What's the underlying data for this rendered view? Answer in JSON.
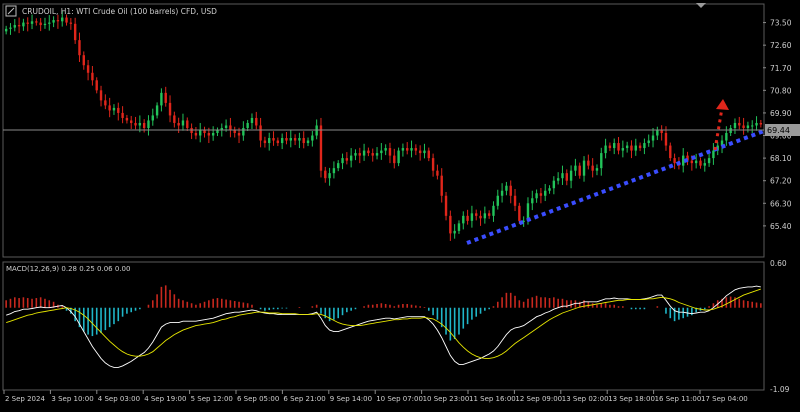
{
  "window": {
    "symbol_line": "CRUDOIL, H1:  WTI Crude Oil (100 barrels) CFD, USD",
    "current_price_tag": "69.44"
  },
  "colors": {
    "background": "#000000",
    "up_candle": "#22c35a",
    "down_candle": "#e0261b",
    "grid_line": "#7a7a7a",
    "trendline_blue": "#3a4dff",
    "arrow_red": "#e0261b",
    "macd_hist_pos": "#c8281e",
    "macd_hist_neg": "#1fb6c8",
    "macd_line": "#ffffff",
    "signal_line": "#e6e600",
    "text": "#cfcfcf"
  },
  "icons": [
    "window-menu-icon",
    "scroll-marker-icon"
  ],
  "chart_data": [
    {
      "type": "candlestick",
      "title": "CRUDOIL, H1:  WTI Crude Oil (100 barrels) CFD, USD",
      "ylim": [
        64.2,
        74.2
      ],
      "y_ticks": [
        "73.50",
        "72.60",
        "71.70",
        "70.80",
        "69.90",
        "69.00",
        "68.10",
        "67.20",
        "66.30",
        "65.40"
      ],
      "x_labels": [
        "2 Sep 2024",
        "3 Sep 10:00",
        "4 Sep 03:00",
        "4 Sep 19:00",
        "5 Sep 12:00",
        "6 Sep 05:00",
        "6 Sep 21:00",
        "9 Sep 14:00",
        "10 Sep 07:00",
        "10 Sep 23:00",
        "11 Sep 16:00",
        "12 Sep 09:00",
        "13 Sep 02:00",
        "13 Sep 18:00",
        "16 Sep 11:00",
        "17 Sep 04:00"
      ],
      "current_price": 69.44,
      "close": [
        73.25,
        73.3,
        73.4,
        73.35,
        73.5,
        73.45,
        73.55,
        73.5,
        73.4,
        73.45,
        73.5,
        73.6,
        73.55,
        73.7,
        73.5,
        73.45,
        72.8,
        72.2,
        71.8,
        71.5,
        71.2,
        70.8,
        70.4,
        70.2,
        70.0,
        70.1,
        69.9,
        69.7,
        69.6,
        69.5,
        69.4,
        69.5,
        69.3,
        69.6,
        69.8,
        70.2,
        70.7,
        70.3,
        69.8,
        69.5,
        69.4,
        69.6,
        69.3,
        69.1,
        69.0,
        69.2,
        69.1,
        69.0,
        69.1,
        69.2,
        69.3,
        69.4,
        69.2,
        69.1,
        69.0,
        69.3,
        69.5,
        69.7,
        69.4,
        68.8,
        68.7,
        68.9,
        68.8,
        68.7,
        68.9,
        68.8,
        68.9,
        68.8,
        68.9,
        68.7,
        68.8,
        69.0,
        69.4,
        67.6,
        67.3,
        67.5,
        67.7,
        67.9,
        68.1,
        68.0,
        68.2,
        68.3,
        68.2,
        68.4,
        68.3,
        68.2,
        68.3,
        68.4,
        68.5,
        68.2,
        67.9,
        68.4,
        68.5,
        68.4,
        68.5,
        68.4,
        68.3,
        68.4,
        68.1,
        67.6,
        67.4,
        66.6,
        65.8,
        65.1,
        65.2,
        65.5,
        65.8,
        65.6,
        65.9,
        65.8,
        65.7,
        65.9,
        65.8,
        66.2,
        66.6,
        66.8,
        67.0,
        66.6,
        66.2,
        65.6,
        65.6,
        66.3,
        66.5,
        66.7,
        66.6,
        66.8,
        66.9,
        67.2,
        67.3,
        67.5,
        67.2,
        67.6,
        67.8,
        67.4,
        68.0,
        67.8,
        67.6,
        67.7,
        68.3,
        68.6,
        68.5,
        68.7,
        68.4,
        68.5,
        68.6,
        68.4,
        68.6,
        68.5,
        68.7,
        68.8,
        69.0,
        69.2,
        69.1,
        68.6,
        68.1,
        67.9,
        67.8,
        68.2,
        68.0,
        67.9,
        68.0,
        67.8,
        67.9,
        68.1,
        68.4,
        68.6,
        68.8,
        69.1,
        69.3,
        69.5,
        69.4,
        69.3,
        69.4,
        69.4,
        69.5,
        69.44
      ]
    },
    {
      "type": "macd",
      "label": "MACD(12,26,9) 0.28 0.25 0.06 0.00",
      "ylim": [
        -1.09,
        0.6
      ],
      "y_ticks": [
        "0.60",
        "-1.09"
      ],
      "histogram": [
        0.1,
        0.12,
        0.14,
        0.13,
        0.14,
        0.13,
        0.12,
        0.13,
        0.14,
        0.12,
        0.1,
        0.08,
        0.04,
        0.02,
        -0.04,
        -0.08,
        -0.18,
        -0.26,
        -0.32,
        -0.36,
        -0.38,
        -0.36,
        -0.34,
        -0.3,
        -0.26,
        -0.22,
        -0.18,
        -0.12,
        -0.08,
        -0.06,
        -0.04,
        -0.02,
        0.0,
        0.04,
        0.1,
        0.18,
        0.28,
        0.3,
        0.24,
        0.18,
        0.12,
        0.1,
        0.08,
        0.06,
        0.04,
        0.06,
        0.08,
        0.1,
        0.12,
        0.13,
        0.12,
        0.11,
        0.1,
        0.09,
        0.08,
        0.07,
        0.06,
        0.04,
        0.0,
        -0.02,
        -0.04,
        -0.03,
        -0.02,
        -0.02,
        -0.01,
        -0.01,
        0.0,
        0.0,
        0.01,
        0.0,
        0.0,
        0.02,
        0.04,
        -0.08,
        -0.14,
        -0.18,
        -0.16,
        -0.14,
        -0.1,
        -0.06,
        -0.04,
        -0.02,
        0.0,
        0.02,
        0.04,
        0.04,
        0.05,
        0.06,
        0.05,
        0.04,
        0.02,
        0.04,
        0.05,
        0.05,
        0.04,
        0.03,
        0.02,
        0.01,
        -0.04,
        -0.1,
        -0.16,
        -0.26,
        -0.36,
        -0.44,
        -0.42,
        -0.36,
        -0.28,
        -0.22,
        -0.16,
        -0.12,
        -0.08,
        -0.04,
        -0.02,
        0.02,
        0.08,
        0.14,
        0.2,
        0.2,
        0.16,
        0.1,
        0.08,
        0.12,
        0.14,
        0.16,
        0.14,
        0.14,
        0.13,
        0.14,
        0.12,
        0.12,
        0.1,
        0.1,
        0.1,
        0.08,
        0.1,
        0.08,
        0.06,
        0.04,
        0.06,
        0.06,
        0.04,
        0.04,
        0.02,
        0.02,
        0.0,
        -0.02,
        -0.02,
        -0.02,
        -0.02,
        0.0,
        0.0,
        0.02,
        0.0,
        -0.08,
        -0.14,
        -0.18,
        -0.16,
        -0.14,
        -0.12,
        -0.1,
        -0.06,
        -0.04,
        -0.02,
        0.02,
        0.06,
        0.1,
        0.12,
        0.14,
        0.15,
        0.14,
        0.12,
        0.1,
        0.09,
        0.08,
        0.07,
        0.06
      ],
      "macd": [
        -0.1,
        -0.08,
        -0.05,
        -0.04,
        -0.02,
        -0.02,
        -0.01,
        0.0,
        0.01,
        0.0,
        0.0,
        0.01,
        0.02,
        0.03,
        0.0,
        -0.05,
        -0.12,
        -0.22,
        -0.32,
        -0.42,
        -0.52,
        -0.6,
        -0.68,
        -0.74,
        -0.78,
        -0.8,
        -0.8,
        -0.78,
        -0.75,
        -0.72,
        -0.68,
        -0.64,
        -0.6,
        -0.54,
        -0.46,
        -0.36,
        -0.26,
        -0.22,
        -0.2,
        -0.2,
        -0.2,
        -0.18,
        -0.18,
        -0.18,
        -0.18,
        -0.17,
        -0.16,
        -0.15,
        -0.14,
        -0.12,
        -0.1,
        -0.08,
        -0.07,
        -0.06,
        -0.06,
        -0.05,
        -0.04,
        -0.03,
        -0.04,
        -0.06,
        -0.07,
        -0.08,
        -0.08,
        -0.09,
        -0.09,
        -0.09,
        -0.09,
        -0.09,
        -0.09,
        -0.09,
        -0.09,
        -0.08,
        -0.06,
        -0.14,
        -0.24,
        -0.3,
        -0.32,
        -0.32,
        -0.3,
        -0.28,
        -0.26,
        -0.24,
        -0.22,
        -0.2,
        -0.18,
        -0.17,
        -0.16,
        -0.15,
        -0.14,
        -0.14,
        -0.15,
        -0.14,
        -0.13,
        -0.12,
        -0.12,
        -0.12,
        -0.12,
        -0.12,
        -0.16,
        -0.22,
        -0.3,
        -0.4,
        -0.52,
        -0.64,
        -0.72,
        -0.76,
        -0.76,
        -0.74,
        -0.72,
        -0.7,
        -0.68,
        -0.65,
        -0.62,
        -0.58,
        -0.52,
        -0.44,
        -0.36,
        -0.3,
        -0.27,
        -0.26,
        -0.24,
        -0.2,
        -0.16,
        -0.12,
        -0.1,
        -0.07,
        -0.05,
        -0.02,
        0.0,
        0.02,
        0.02,
        0.04,
        0.06,
        0.06,
        0.08,
        0.08,
        0.08,
        0.08,
        0.1,
        0.12,
        0.12,
        0.13,
        0.12,
        0.12,
        0.12,
        0.11,
        0.11,
        0.11,
        0.12,
        0.13,
        0.15,
        0.17,
        0.17,
        0.1,
        0.02,
        -0.04,
        -0.06,
        -0.06,
        -0.07,
        -0.08,
        -0.07,
        -0.06,
        -0.06,
        -0.04,
        0.0,
        0.05,
        0.1,
        0.16,
        0.2,
        0.24,
        0.26,
        0.27,
        0.28,
        0.28,
        0.29,
        0.28
      ],
      "signal": [
        -0.2,
        -0.18,
        -0.16,
        -0.14,
        -0.12,
        -0.1,
        -0.09,
        -0.07,
        -0.06,
        -0.05,
        -0.04,
        -0.03,
        -0.02,
        -0.01,
        0.0,
        -0.01,
        -0.03,
        -0.06,
        -0.1,
        -0.15,
        -0.21,
        -0.27,
        -0.33,
        -0.39,
        -0.45,
        -0.5,
        -0.55,
        -0.59,
        -0.62,
        -0.64,
        -0.65,
        -0.65,
        -0.64,
        -0.62,
        -0.59,
        -0.54,
        -0.49,
        -0.44,
        -0.4,
        -0.36,
        -0.33,
        -0.3,
        -0.28,
        -0.26,
        -0.24,
        -0.23,
        -0.22,
        -0.21,
        -0.2,
        -0.18,
        -0.16,
        -0.15,
        -0.13,
        -0.12,
        -0.1,
        -0.09,
        -0.08,
        -0.07,
        -0.06,
        -0.06,
        -0.06,
        -0.07,
        -0.07,
        -0.07,
        -0.08,
        -0.08,
        -0.08,
        -0.08,
        -0.09,
        -0.09,
        -0.09,
        -0.09,
        -0.08,
        -0.09,
        -0.11,
        -0.14,
        -0.17,
        -0.2,
        -0.22,
        -0.23,
        -0.24,
        -0.24,
        -0.24,
        -0.23,
        -0.22,
        -0.21,
        -0.2,
        -0.19,
        -0.18,
        -0.17,
        -0.16,
        -0.16,
        -0.15,
        -0.15,
        -0.14,
        -0.14,
        -0.14,
        -0.13,
        -0.14,
        -0.15,
        -0.18,
        -0.22,
        -0.27,
        -0.33,
        -0.4,
        -0.47,
        -0.53,
        -0.58,
        -0.62,
        -0.65,
        -0.67,
        -0.68,
        -0.68,
        -0.67,
        -0.65,
        -0.62,
        -0.58,
        -0.53,
        -0.48,
        -0.44,
        -0.4,
        -0.36,
        -0.32,
        -0.28,
        -0.24,
        -0.2,
        -0.16,
        -0.13,
        -0.1,
        -0.07,
        -0.05,
        -0.03,
        -0.01,
        0.01,
        0.02,
        0.03,
        0.04,
        0.05,
        0.06,
        0.07,
        0.08,
        0.09,
        0.1,
        0.1,
        0.11,
        0.11,
        0.11,
        0.11,
        0.11,
        0.12,
        0.12,
        0.13,
        0.14,
        0.13,
        0.12,
        0.1,
        0.07,
        0.05,
        0.03,
        0.01,
        -0.01,
        -0.02,
        -0.03,
        -0.03,
        -0.02,
        0.0,
        0.02,
        0.05,
        0.08,
        0.11,
        0.14,
        0.17,
        0.19,
        0.21,
        0.23,
        0.25
      ]
    }
  ]
}
